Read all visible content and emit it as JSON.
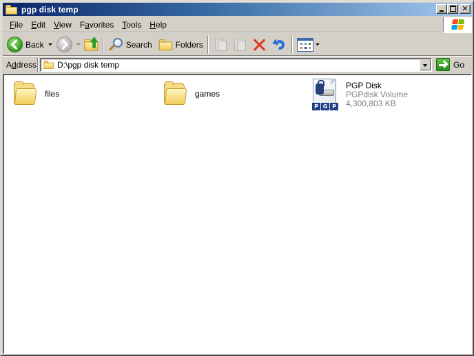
{
  "window": {
    "title": "pgp disk temp",
    "title_icon": "folder-icon",
    "caption_buttons": [
      "minimize",
      "maximize",
      "close"
    ]
  },
  "menu": {
    "items": [
      {
        "label": "File",
        "accel": "F",
        "rest": "ile"
      },
      {
        "label": "Edit",
        "accel": "E",
        "rest": "dit"
      },
      {
        "label": "View",
        "accel": "V",
        "rest": "iew"
      },
      {
        "label": "Favorites",
        "accel": "a",
        "pre": "F",
        "rest": "vorites"
      },
      {
        "label": "Tools",
        "accel": "T",
        "rest": "ools"
      },
      {
        "label": "Help",
        "accel": "H",
        "rest": "elp"
      }
    ],
    "brand_icon": "windows-logo-icon"
  },
  "toolbar": {
    "back_label": "Back",
    "search_label": "Search",
    "folders_label": "Folders",
    "buttons": [
      "back",
      "forward",
      "up",
      "search",
      "folders",
      "move-to",
      "copy-to",
      "delete",
      "undo",
      "views"
    ]
  },
  "address": {
    "label_pre": "A",
    "label_accel": "d",
    "label_rest": "dress",
    "value": "D:\\pgp disk temp",
    "go_label": "Go"
  },
  "content": {
    "items": [
      {
        "name": "files",
        "type": "folder"
      },
      {
        "name": "games",
        "type": "folder"
      },
      {
        "name": "PGP Disk",
        "type": "PGPdisk Volume",
        "size": "4,300,803 KB",
        "icon_text": [
          "P",
          "G",
          "P"
        ]
      }
    ]
  },
  "colors": {
    "titlebar_start": "#0a246a",
    "titlebar_end": "#a6caf0",
    "chrome": "#d4d0c8",
    "delete_red": "#e0361a",
    "undo_blue": "#2a6fd4",
    "secondary_text": "#808080"
  }
}
